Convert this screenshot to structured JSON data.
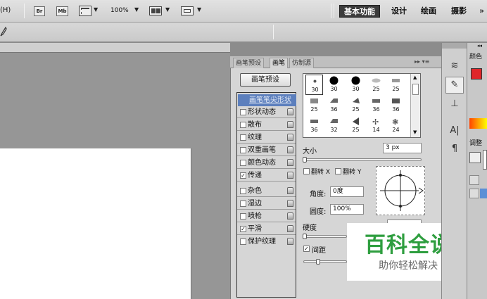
{
  "menubar": {
    "help": "(H)"
  },
  "toolbar": {
    "br": "Br",
    "mb": "Mb",
    "zoom": "100%",
    "dropdown_arrow": "▼"
  },
  "workspace": {
    "basic": "基本功能",
    "design": "设计",
    "paint": "绘画",
    "photo": "摄影",
    "more": "»"
  },
  "panel": {
    "tabs": [
      "画笔预设",
      "画笔",
      "仿制源"
    ],
    "preset_button": "画笔预设",
    "options": [
      {
        "label": "画笔笔尖形状",
        "checked": null,
        "active": true
      },
      {
        "label": "形状动态",
        "checked": false
      },
      {
        "label": "散布",
        "checked": false
      },
      {
        "label": "纹理",
        "checked": false
      },
      {
        "label": "双重画笔",
        "checked": false
      },
      {
        "label": "颜色动态",
        "checked": false
      },
      {
        "label": "传递",
        "checked": true
      },
      {
        "label": "杂色",
        "checked": false
      },
      {
        "label": "湿边",
        "checked": false
      },
      {
        "label": "喷枪",
        "checked": false
      },
      {
        "label": "平滑",
        "checked": true
      },
      {
        "label": "保护纹理",
        "checked": false
      }
    ],
    "tip_sizes": [
      "30",
      "30",
      "30",
      "25",
      "25",
      "25",
      "36",
      "25",
      "36",
      "36",
      "36",
      "32",
      "25",
      "14",
      "24"
    ],
    "size_label": "大小",
    "size_value": "3 px",
    "flip_x": "翻转 X",
    "flip_y": "翻转 Y",
    "angle_label": "角度:",
    "angle_value": "0度",
    "roundness_label": "圆度:",
    "roundness_value": "100%",
    "hardness_label": "硬度",
    "spacing_label": "间距",
    "menu_icon": "▸▸ ▾≡"
  },
  "right": {
    "collapse": "◂◂",
    "color_label": "颜色",
    "adjust_label": "调整",
    "foreground_color": "#e0262a"
  },
  "watermark": {
    "title": "百科全说",
    "subtitle": "助你轻松解决"
  }
}
